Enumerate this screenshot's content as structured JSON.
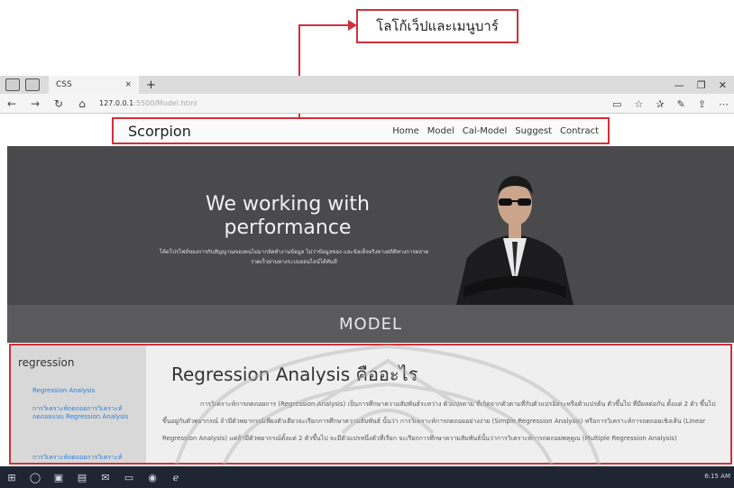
{
  "annotation": {
    "label": "โลโก้เว็ปและเมนูบาร์",
    "color": "#d0303a"
  },
  "browser": {
    "tab_title": "CSS",
    "tab_close": "×",
    "new_tab": "+",
    "url": "127.0.0.1",
    "url_path": ":5500/Model.html",
    "icons": [
      "back-icon",
      "forward-icon",
      "refresh-icon",
      "home-icon",
      "reading-view-icon",
      "favorite-icon",
      "favorites-icon",
      "pen-icon",
      "share-icon",
      "more-icon"
    ]
  },
  "site": {
    "brand": "Scorpion",
    "menu": [
      "Home",
      "Model",
      "Cal-Model",
      "Suggest",
      "Contract"
    ]
  },
  "hero": {
    "title": "We working with performance",
    "subtitle": "โค้ดโปรไฟล์ของการกับสัญญาณของคนไม่มากจัดทำงานข้อมูล ไม่ว่าข้อมูลของ และข้อเท็จจริงทางสถิติทางการตลาดรวดเร็วผ่านทางระบบออนไลน์ได้ทันที"
  },
  "model_band": {
    "label": "MODEL"
  },
  "sidebar": {
    "heading": "regression",
    "links": [
      "Regression Analysis",
      "การวิเคราะห์ถดถอยการวิเคราะห์ถดถอยแบบ Regression Analysis",
      "การวิเคราะห์ถดถอยการวิเคราะห์"
    ]
  },
  "main": {
    "heading": "Regression Analysis คืออะไร",
    "paragraph": "การวิเคราะห์การถดถอยการ (Regression Analysis) เป็นการศึกษาความสัมพันธ์ระหว่าง ตัวแปรตาม ที่เกิดจากตัวตามที่กับตัวแปรอิสระหรือตัวแปรต้น ตัวขึ้นไป ที่มีผลต่อกัน ตั้งแต่ 2 ตัว ขึ้นไป ขึ้นอยู่กับตัวพยากรณ์ ถ้ามีตัวพยากรณ์เพียงตัวเดียวจะเรียกการศึกษาความสัมพันธ์ นั้นว่า การวิเคราะห์การถดถอยอย่างง่าย (Simple Regression Analysis) หรือการวิเคราะห์การถดถอยเชิงเส้น (Linear Regression Analysis) แต่ถ้ามีตัวพยากรณ์ตั้งแต่ 2 ตัวขึ้นไป จะมีตัวแปรหนึ่งตัวที่เรียก จะเรียกการศึกษาความสัมพันธ์นั้นว่าการวิเคราะห์การถดถอยพหุคูณ (Multiple Regression Analysis)"
  },
  "taskbar": {
    "icons": [
      "windows-start-icon",
      "search-icon",
      "task-view-icon",
      "store-icon",
      "mail-icon",
      "file-explorer-icon",
      "chrome-icon",
      "edge-icon"
    ],
    "clock": "6:15 AM"
  }
}
